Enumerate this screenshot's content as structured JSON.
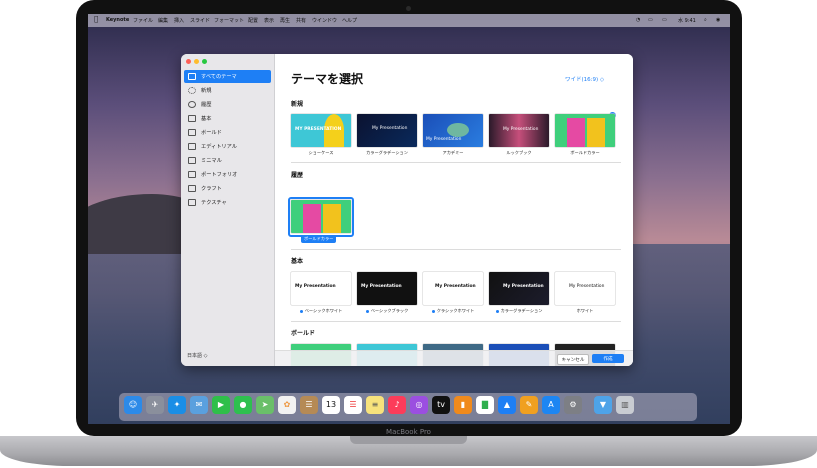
{
  "menubar": {
    "app": "Keynote",
    "items": [
      "ファイル",
      "編集",
      "挿入",
      "スライド",
      "フォーマット",
      "配置",
      "表示",
      "再生",
      "共有",
      "ウインドウ",
      "ヘルプ"
    ],
    "clock": "水 9:41"
  },
  "sidebar": {
    "items": [
      {
        "label": "すべてのテーマ",
        "icon": "all-themes-icon",
        "selected": true
      },
      {
        "label": "新規",
        "icon": "new-icon"
      },
      {
        "label": "履歴",
        "icon": "history-icon"
      },
      {
        "label": "基本",
        "icon": "basic-icon"
      },
      {
        "label": "ボールド",
        "icon": "bold-icon"
      },
      {
        "label": "エディトリアル",
        "icon": "editorial-icon"
      },
      {
        "label": "ミニマル",
        "icon": "minimal-icon"
      },
      {
        "label": "ポートフォリオ",
        "icon": "portfolio-icon"
      },
      {
        "label": "クラフト",
        "icon": "craft-icon"
      },
      {
        "label": "テクスチャ",
        "icon": "texture-icon"
      }
    ],
    "language": "日本語 ◇"
  },
  "main": {
    "title": "テーマを選択",
    "aspect": "ワイド(16:9) ◇",
    "sections": {
      "new": "新規",
      "recent": "履歴",
      "basic": "基本",
      "bold": "ボールド"
    },
    "new_themes": [
      "ショーケース",
      "カラーグラデーション",
      "アカデミー",
      "ルックブック",
      "ボールドカラー"
    ],
    "recent_themes": [
      "ボールドカラー"
    ],
    "basic_themes": [
      "ベーシックホワイト",
      "ベーシックブラック",
      "クラシックホワイト",
      "カラーグラデーション",
      "ホワイト"
    ],
    "thumb_text": {
      "my_presentation_upper": "MY PRESENTATION",
      "my_presentation": "My Presentation",
      "presentation_subtitle": "Presentation Subtitle"
    }
  },
  "buttons": {
    "cancel": "キャンセル",
    "create": "作成"
  },
  "dock_icons": [
    "finder-icon",
    "launchpad-icon",
    "safari-icon",
    "mail-icon",
    "facetime-icon",
    "messages-icon",
    "maps-icon",
    "photos-icon",
    "contacts-icon",
    "calendar-icon",
    "reminders-icon",
    "notes-icon",
    "music-icon",
    "podcasts-icon",
    "tv-icon",
    "books-icon",
    "numbers-icon",
    "keynote-icon",
    "pages-icon",
    "app-store-icon",
    "system-preferences-icon",
    "downloads-icon",
    "trash-icon"
  ],
  "calendar_day": "13",
  "device_label": "MacBook Pro",
  "colors": {
    "accent": "#1e7ff5"
  }
}
